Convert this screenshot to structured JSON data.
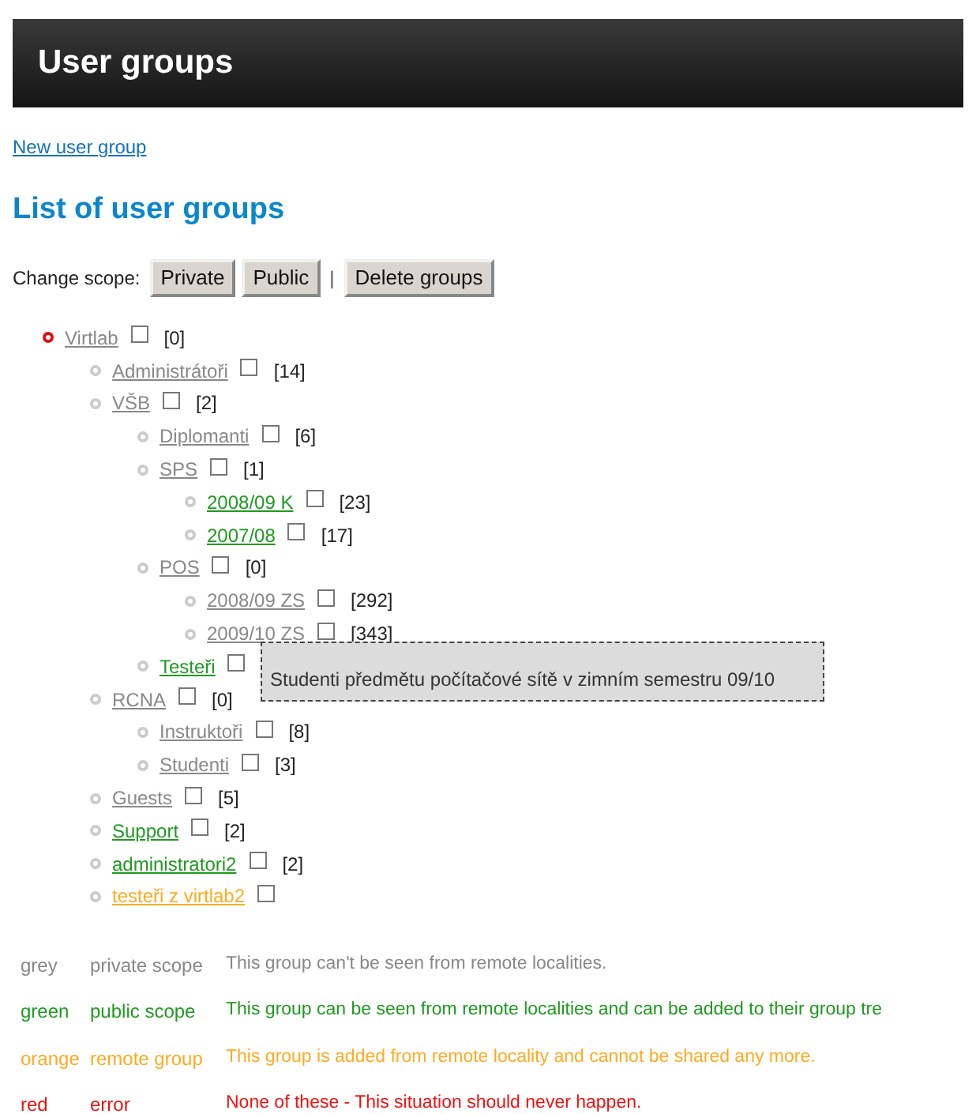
{
  "header": {
    "title": "User groups"
  },
  "new_link": "New user group",
  "heading": "List of user groups",
  "scope_bar": {
    "label": "Change scope:",
    "buttons": [
      "Private",
      "Public"
    ],
    "separator": "|",
    "delete_button": "Delete groups"
  },
  "tree": [
    {
      "name": "Virtlab",
      "color": "#888888",
      "selected": true,
      "checked": false,
      "count": "[0]",
      "children": [
        {
          "name": "Administrátoři",
          "color": "#888888",
          "selected": false,
          "checked": false,
          "count": "[14]"
        },
        {
          "name": "VŠB",
          "color": "#888888",
          "selected": false,
          "checked": false,
          "count": "[2]",
          "children": [
            {
              "name": "Diplomanti",
              "color": "#888888",
              "selected": false,
              "checked": false,
              "count": "[6]"
            },
            {
              "name": "SPS",
              "color": "#888888",
              "selected": false,
              "checked": false,
              "count": "[1]",
              "children": [
                {
                  "name": "2008/09 K",
                  "color": "#1f9a1f",
                  "selected": false,
                  "checked": false,
                  "count": "[23]"
                },
                {
                  "name": "2007/08",
                  "color": "#1f9a1f",
                  "selected": false,
                  "checked": false,
                  "count": "[17]"
                }
              ]
            },
            {
              "name": "POS",
              "color": "#888888",
              "selected": false,
              "checked": false,
              "count": "[0]",
              "children": [
                {
                  "name": "2008/09 ZS",
                  "color": "#888888",
                  "selected": false,
                  "checked": false,
                  "count": "[292]"
                },
                {
                  "name": "2009/10 ZS",
                  "color": "#888888",
                  "selected": false,
                  "checked": false,
                  "count": "[343]"
                }
              ]
            },
            {
              "name": "Testeři",
              "color": "#1f9a1f",
              "selected": false,
              "checked": false
            }
          ]
        },
        {
          "name": "RCNA",
          "color": "#888888",
          "selected": false,
          "checked": false,
          "count": "[0]",
          "children": [
            {
              "name": "Instruktoři",
              "color": "#888888",
              "selected": false,
              "checked": false,
              "count": "[8]"
            },
            {
              "name": "Studenti",
              "color": "#888888",
              "selected": false,
              "checked": false,
              "count": "[3]"
            }
          ]
        },
        {
          "name": "Guests",
          "color": "#888888",
          "selected": false,
          "checked": false,
          "count": "[5]"
        },
        {
          "name": "Support",
          "color": "#1f9a1f",
          "selected": false,
          "checked": false,
          "count": "[2]"
        },
        {
          "name": "administratori2",
          "color": "#1f9a1f",
          "selected": false,
          "checked": false,
          "count": "[2]"
        },
        {
          "name": "testeři z virtlab2",
          "color": "#ffaa22",
          "selected": false,
          "checked": false
        }
      ]
    }
  ],
  "tooltip": "Studenti předmětu počítačové sítě v zimním semestru 09/10",
  "legend": [
    {
      "color": "#888888",
      "color_name": "grey",
      "meaning": "private scope",
      "description": "This group can't be seen from remote localities."
    },
    {
      "color": "#1f9a1f",
      "color_name": "green",
      "meaning": "public scope",
      "description": "This group can be seen from remote localities and can be added to their group tre"
    },
    {
      "color": "#ffaa22",
      "color_name": "orange",
      "meaning": "remote group",
      "description": "This group is added from remote locality and cannot be shared any more."
    },
    {
      "color": "#ee1111",
      "color_name": "red",
      "meaning": "error",
      "description": "None of these - This situation should never happen."
    }
  ]
}
